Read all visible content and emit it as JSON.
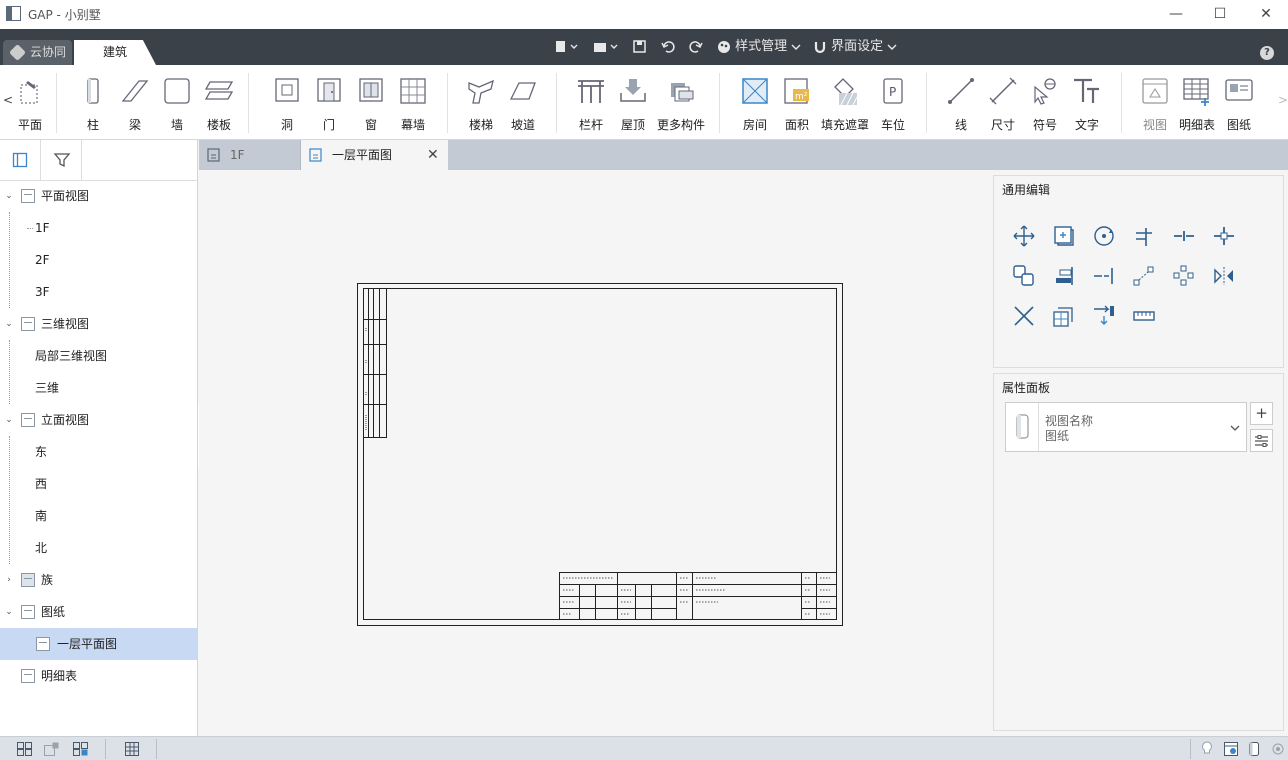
{
  "window": {
    "title": "GAP - 小别墅",
    "minimize": "—",
    "maximize": "☐",
    "close": "✕"
  },
  "menubar": {
    "cloud_tab": "云协同",
    "arch_tab": "建筑",
    "style_menu": "样式管理",
    "ui_settings": "界面设定",
    "help": "?"
  },
  "ribbon": {
    "items": [
      "平面",
      "柱",
      "梁",
      "墙",
      "楼板",
      "洞",
      "门",
      "窗",
      "幕墙",
      "楼梯",
      "坡道",
      "栏杆",
      "屋顶",
      "更多构件",
      "房间",
      "面积",
      "填充遮罩",
      "车位",
      "线",
      "尺寸",
      "符号",
      "文字",
      "视图",
      "明细表",
      "图纸"
    ],
    "scroll_left": "<",
    "scroll_right": ">"
  },
  "tree": {
    "plan_views": "平面视图",
    "plan_1f": "1F",
    "plan_2f": "2F",
    "plan_3f": "3F",
    "views_3d": "三维视图",
    "local_3d": "局部三维视图",
    "three_d": "三维",
    "elevations": "立面视图",
    "east": "东",
    "west": "西",
    "south": "南",
    "north": "北",
    "family": "族",
    "sheets": "图纸",
    "sheet_1": "一层平面图",
    "schedule": "明细表"
  },
  "tabs": [
    {
      "label": "1F",
      "active": false
    },
    {
      "label": "一层平面图",
      "active": true
    }
  ],
  "right_panel": {
    "edit_title": "通用编辑",
    "prop_title": "属性面板",
    "prop_name_label": "视图名称",
    "prop_name_value": "图纸",
    "add": "+"
  },
  "colors": {
    "menubar": "#3b4148",
    "tabbar": "#c3cad3",
    "selected": "#c7d9f3",
    "accent": "#3a86c8"
  }
}
